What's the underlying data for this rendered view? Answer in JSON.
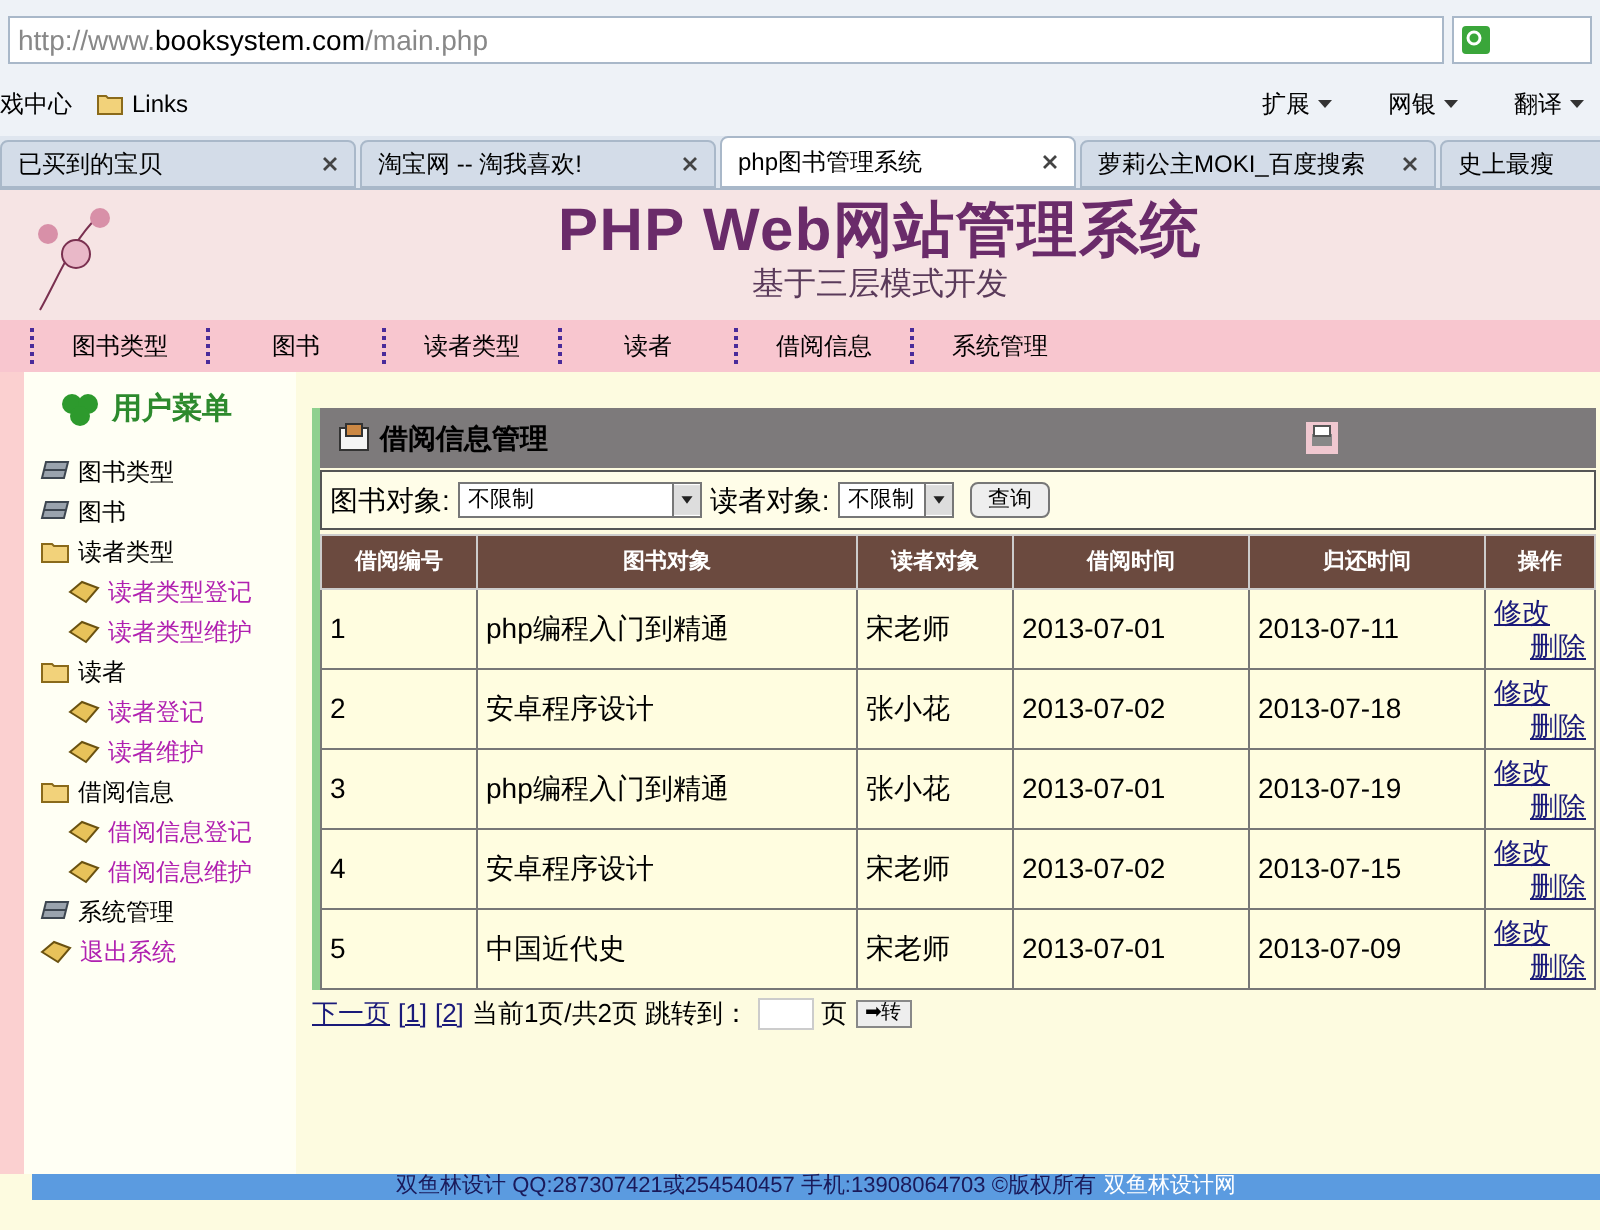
{
  "browser": {
    "url_host": "http://www.",
    "url_domain": "booksystem.com",
    "url_path": "/main.php",
    "bookmarks": [
      "戏中心",
      "Links"
    ],
    "toolbar": [
      "扩展",
      "网银",
      "翻译"
    ],
    "tabs": [
      {
        "label": "已买到的宝贝",
        "selected": false
      },
      {
        "label": "淘宝网 -- 淘我喜欢!",
        "selected": false
      },
      {
        "label": "php图书管理系统",
        "selected": true
      },
      {
        "label": "萝莉公主MOKI_百度搜索",
        "selected": false
      },
      {
        "label": "史上最瘦",
        "selected": false
      }
    ]
  },
  "banner": {
    "title": "PHP Web网站管理系统",
    "subtitle": "基于三层模式开发"
  },
  "nav": [
    "图书类型",
    "图书",
    "读者类型",
    "读者",
    "借阅信息",
    "系统管理"
  ],
  "sidebar": {
    "title": "用户菜单",
    "items": [
      {
        "label": "图书类型",
        "kind": "module"
      },
      {
        "label": "图书",
        "kind": "module"
      },
      {
        "label": "读者类型",
        "kind": "folder",
        "children": [
          {
            "label": "读者类型登记"
          },
          {
            "label": "读者类型维护"
          }
        ]
      },
      {
        "label": "读者",
        "kind": "folder",
        "children": [
          {
            "label": "读者登记"
          },
          {
            "label": "读者维护"
          }
        ]
      },
      {
        "label": "借阅信息",
        "kind": "folder",
        "children": [
          {
            "label": "借阅信息登记"
          },
          {
            "label": "借阅信息维护"
          }
        ]
      },
      {
        "label": "系统管理",
        "kind": "module"
      },
      {
        "label": "退出系统",
        "kind": "link"
      }
    ]
  },
  "panel": {
    "title": "借阅信息管理",
    "filters": [
      {
        "label": "图书对象:",
        "value": "不限制"
      },
      {
        "label": "读者对象:",
        "value": "不限制"
      }
    ],
    "query_button": "查询",
    "table": {
      "columns": [
        "借阅编号",
        "图书对象",
        "读者对象",
        "借阅时间",
        "归还时间",
        "操作"
      ],
      "rows": [
        {
          "cells": [
            "1",
            "php编程入门到精通",
            "宋老师",
            "2013-07-01",
            "2013-07-11"
          ],
          "actions": [
            "修改",
            "删除"
          ]
        },
        {
          "cells": [
            "2",
            "安卓程序设计",
            "张小花",
            "2013-07-02",
            "2013-07-18"
          ],
          "actions": [
            "修改",
            "删除"
          ]
        },
        {
          "cells": [
            "3",
            "php编程入门到精通",
            "张小花",
            "2013-07-01",
            "2013-07-19"
          ],
          "actions": [
            "修改",
            "删除"
          ]
        },
        {
          "cells": [
            "4",
            "安卓程序设计",
            "宋老师",
            "2013-07-02",
            "2013-07-15"
          ],
          "actions": [
            "修改",
            "删除"
          ]
        },
        {
          "cells": [
            "5",
            "中国近代史",
            "宋老师",
            "2013-07-01",
            "2013-07-09"
          ],
          "actions": [
            "修改",
            "删除"
          ]
        }
      ]
    },
    "pager": {
      "next": "下一页",
      "pages": [
        "[1]",
        "[2]"
      ],
      "info": "当前1页/共2页 跳转到：",
      "unit": "页",
      "go": "➡转"
    }
  },
  "footer": {
    "text": "双鱼林设计 QQ:287307421或254540457 手机:13908064703 ©版权所有",
    "link": "双鱼林设计网"
  }
}
